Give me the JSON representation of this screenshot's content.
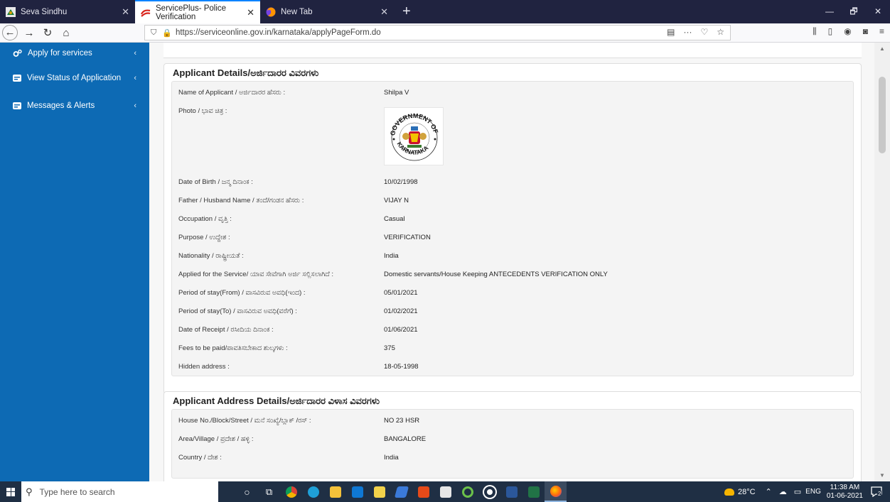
{
  "browser": {
    "tabs": [
      {
        "title": "Seva Sindhu",
        "active": false
      },
      {
        "title": "ServicePlus- Police Verification",
        "active": true
      },
      {
        "title": "New Tab",
        "active": false
      }
    ],
    "url": "https://serviceonline.gov.in/karnataka/applyPageForm.do"
  },
  "sidebar": {
    "items": [
      {
        "label": "Apply for services",
        "icon": "gears-icon"
      },
      {
        "label": "View Status of Application",
        "icon": "card-icon"
      },
      {
        "label": "Messages & Alerts",
        "icon": "card-icon"
      }
    ]
  },
  "applicant": {
    "title": "Applicant Details/ಅರ್ಜಿದಾರರ ವಿವರಗಳು",
    "fields": [
      {
        "label": "Name of Applicant / ಅರ್ಜಿದಾರರ ಹೆಸರು :",
        "value": "Shilpa V"
      },
      {
        "label": "Photo / ಭಾವ ಚಿತ್ರ :",
        "value": ""
      },
      {
        "label": "Date of Birth / ಜನ್ಮ ದಿನಾಂಕ :",
        "value": "10/02/1998"
      },
      {
        "label": "Father / Husband Name / ತಂದೆ/ಗಂಡನ ಹೆಸರು :",
        "value": "VIJAY N"
      },
      {
        "label": "Occupation / ವೃತ್ತಿ :",
        "value": "Casual"
      },
      {
        "label": "Purpose / ಉದ್ದೇಶ :",
        "value": "VERIFICATION"
      },
      {
        "label": "Nationality / ರಾಷ್ಟ್ರೀಯತೆ :",
        "value": "India"
      },
      {
        "label": "Applied for the Service/ ಯಾವ ಸೇವೆಗಾಗಿ ಅರ್ಜಿ ಸಲ್ಲಿಸಲಾಗಿದೆ :",
        "value": "Domestic servants/House Keeping ANTECEDENTS VERIFICATION ONLY"
      },
      {
        "label": "Period of stay(From) / ವಾಸವಿರುವ ಅವಧಿ(ಇಂದ) :",
        "value": "05/01/2021"
      },
      {
        "label": "Period of stay(To) / ವಾಸವಿರುವ ಅವಧಿ(ವರೆಗೆ) :",
        "value": "01/02/2021"
      },
      {
        "label": "Date of Receipt / ರಸೀದಿಯ ದಿನಾಂಕ :",
        "value": "01/06/2021"
      },
      {
        "label": "Fees to be paid/ಪಾವತಿಸಬೇಕಾದ ಶುಲ್ಕಗಳು :",
        "value": "375"
      },
      {
        "label": "Hidden address :",
        "value": "18-05-1998"
      }
    ]
  },
  "address": {
    "title": "Applicant Address Details/ಅರ್ಜಿದಾರರ ವಿಳಾಸ ವಿವರಗಳು",
    "fields": [
      {
        "label": "House No./Block/Street / ಮನೆ ಸಂಖ್ಯೆ/ಬ್ಲಾಕ್ /ರಸ್ :",
        "value": "NO 23 HSR"
      },
      {
        "label": "Area/Village / ಪ್ರದೇಶ / ಹಳ್ಳಿ :",
        "value": "BANGALORE"
      },
      {
        "label": "Country / ದೇಶ :",
        "value": "India"
      }
    ]
  },
  "seal_text": {
    "top": "GOVERNMENT OF",
    "bottom": "KARNATAKA"
  },
  "taskbar": {
    "search_placeholder": "Type here to search",
    "weather": "28°C",
    "lang": "ENG",
    "time": "11:38 AM",
    "date": "01-06-2021",
    "notifications": "2"
  }
}
